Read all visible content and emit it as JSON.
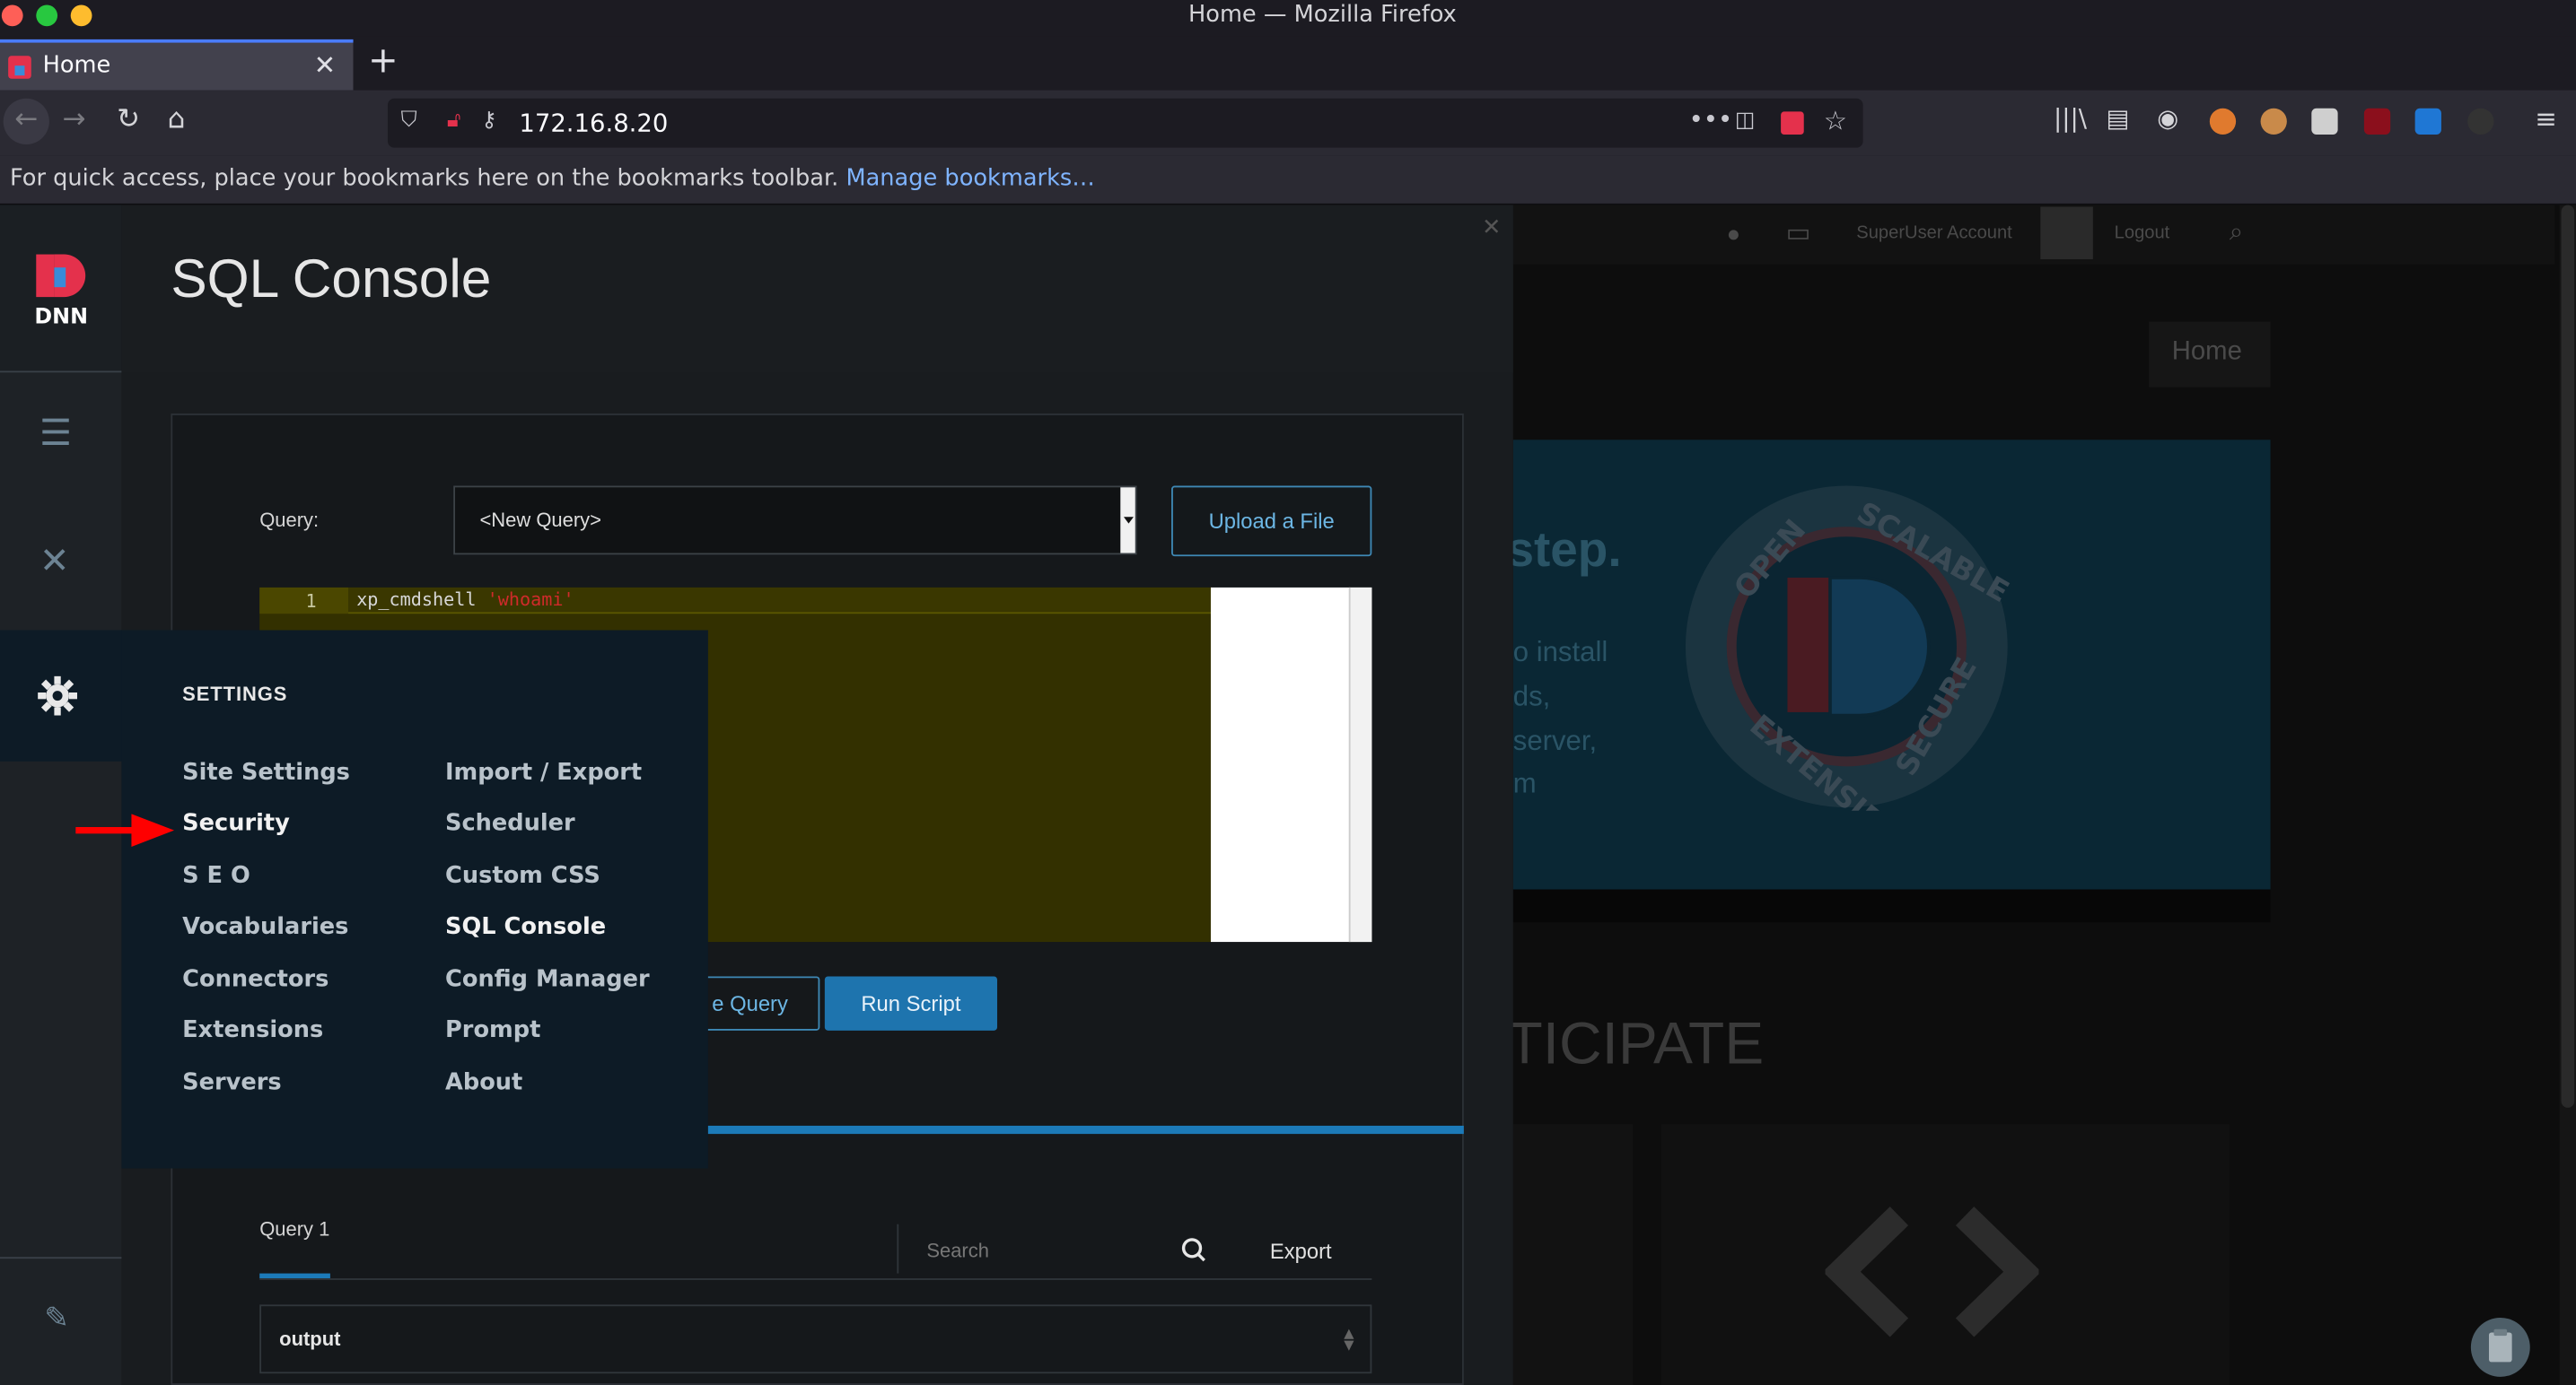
{
  "browser": {
    "window_title": "Home — Mozilla Firefox",
    "tab_title": "Home",
    "url": "172.16.8.20",
    "bookmarks_bar_text": "For quick access, place your bookmarks here on the bookmarks toolbar.",
    "bookmarks_link": "Manage bookmarks…",
    "traffic_light_colors": [
      "#fe5f57",
      "#28c840",
      "#febc2e"
    ]
  },
  "sidebar": {
    "items": [
      {
        "name": "content",
        "icon": "content-list-icon"
      },
      {
        "name": "tools",
        "icon": "tools-icon"
      },
      {
        "name": "settings",
        "icon": "gear-icon"
      },
      {
        "name": "edit",
        "icon": "pencil-icon"
      }
    ]
  },
  "panel": {
    "title": "SQL Console",
    "query_label": "Query:",
    "query_selected": "<New Query>",
    "upload_label": "Upload a File",
    "editor": {
      "line_number": "1",
      "code_command": "xp_cmdshell",
      "code_string": "'whoami'"
    },
    "save_label": "e Query",
    "run_label": "Run Script",
    "results": {
      "tab_label": "Query 1",
      "search_placeholder": "Search",
      "export_label": "Export",
      "column": "output"
    }
  },
  "settings_menu": {
    "header": "SETTINGS",
    "left_column": [
      "Site Settings",
      "Security",
      "S E O",
      "Vocabularies",
      "Connectors",
      "Extensions",
      "Servers"
    ],
    "right_column": [
      "Import / Export",
      "Scheduler",
      "Custom CSS",
      "SQL Console",
      "Config Manager",
      "Prompt",
      "About"
    ],
    "active": [
      "Security",
      "SQL Console"
    ]
  },
  "site_background": {
    "user": "SuperUser Account",
    "logout": "Logout",
    "nav_home": "Home",
    "hero_heading": "step.",
    "hero_lines": [
      "o install",
      "ds,",
      "server,",
      "m"
    ],
    "badge_words": [
      "OPEN",
      "SCALABLE",
      "EXTENSIBLE",
      "SECURE"
    ],
    "section_heading": "TICIPATE"
  },
  "colors": {
    "accent": "#1c7ab8",
    "dnn_red": "#e4314c",
    "flyout_bg": "#0d1b26",
    "editor_bg": "#333000",
    "arrow_red": "#ff0000"
  }
}
